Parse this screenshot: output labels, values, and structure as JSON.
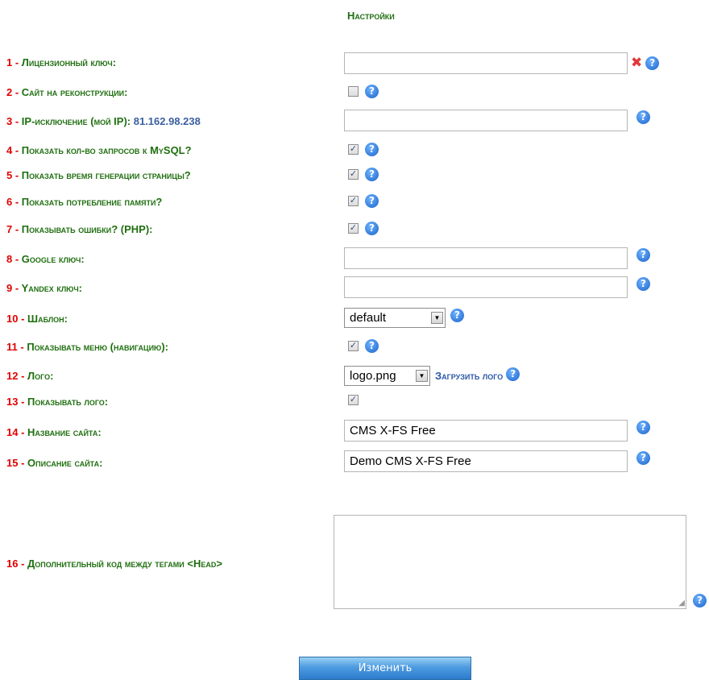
{
  "page_title": "Настройки",
  "help_glyph": "?",
  "rows": [
    {
      "num": "1 -",
      "label": "Лицензионный ключ:",
      "value": ""
    },
    {
      "num": "2 -",
      "label": "Сайт на реконструкции:",
      "checked": false
    },
    {
      "num": "3 -",
      "label": "IP-исключение (мой IP):",
      "ip": "81.162.98.238",
      "value": ""
    },
    {
      "num": "4 -",
      "label": "Показать кол-во запросов к MySQL?",
      "checked": true
    },
    {
      "num": "5 -",
      "label": "Показать время генерации страницы?",
      "checked": true
    },
    {
      "num": "6 -",
      "label": "Показать потребление памяти?",
      "checked": true
    },
    {
      "num": "7 -",
      "label": "Показывать ошибки? (PHP):",
      "checked": true
    },
    {
      "num": "8 -",
      "label": "Google ключ:",
      "value": ""
    },
    {
      "num": "9 -",
      "label": "Yandex ключ:",
      "value": ""
    },
    {
      "num": "10 -",
      "label": "Шаблон:",
      "selected": "default"
    },
    {
      "num": "11 -",
      "label": "Показывать меню (навигацию):",
      "checked": true
    },
    {
      "num": "12 -",
      "label": "Лого:",
      "selected": "logo.png",
      "link": "Загрузить лого"
    },
    {
      "num": "13 -",
      "label": "Показывать лого:",
      "checked": true
    },
    {
      "num": "14 -",
      "label": "Название сайта:",
      "value": "CMS X-FS Free"
    },
    {
      "num": "15 -",
      "label": "Описание сайта:",
      "value": "Demo CMS X-FS Free"
    },
    {
      "num": "16 -",
      "label": "Дополнительный код между тегами <Head>",
      "value": ""
    }
  ],
  "submit_label": "Изменить",
  "colors": {
    "label": "#1f6f10",
    "number": "#e00000",
    "ip": "#3a5fa0",
    "help": "#1a63c9",
    "button": "#4d9be0"
  }
}
